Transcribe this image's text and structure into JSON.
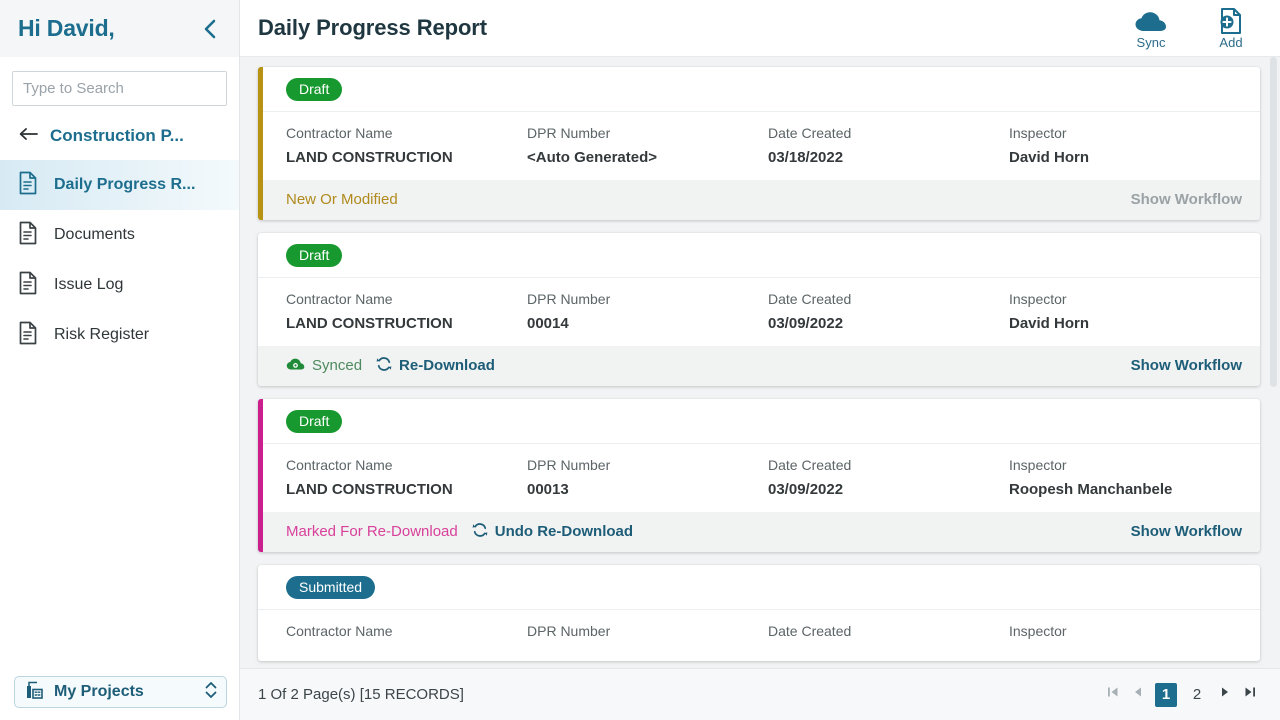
{
  "sidebar": {
    "greeting": "Hi David,",
    "collapse_icon": "chevron-left-icon",
    "search": {
      "placeholder": "Type to Search",
      "value": "",
      "button_icon": "search-icon"
    },
    "back_nav": {
      "icon": "arrow-left-icon",
      "label": "Construction P..."
    },
    "items": [
      {
        "icon": "document-icon",
        "label": "Daily Progress R...",
        "active": true
      },
      {
        "icon": "document-icon",
        "label": "Documents",
        "active": false
      },
      {
        "icon": "document-icon",
        "label": "Issue Log",
        "active": false
      },
      {
        "icon": "document-icon",
        "label": "Risk Register",
        "active": false
      }
    ],
    "projects_selector": {
      "icon": "building-icon",
      "label": "My Projects",
      "chevron_icon": "chevron-up-down-icon"
    }
  },
  "header": {
    "title": "Daily Progress Report",
    "actions": [
      {
        "icon": "cloud-icon",
        "label": "Sync"
      },
      {
        "icon": "document-add-icon",
        "label": "Add"
      }
    ]
  },
  "colors": {
    "accent_teal": "#1d6e8e",
    "badge_draft": "#18992f",
    "badge_submitted": "#1d6e8e",
    "accent_gold": "#b89313",
    "accent_magenta": "#cc1f8e",
    "link_blue": "#1d5d78",
    "synced_green": "#1f8a37",
    "disabled_grey": "#9aa2a6"
  },
  "columns": [
    "Contractor Name",
    "DPR Number",
    "Date Created",
    "Inspector"
  ],
  "cards": [
    {
      "status_badge": "Draft",
      "badge_color": "#18992f",
      "accent_color": "#b89313",
      "values": [
        "LAND CONSTRUCTION",
        "<Auto Generated>",
        "03/18/2022",
        "David Horn"
      ],
      "foot_status": "New Or Modified",
      "foot_status_color": "#b08a1c",
      "foot_status_icon": "",
      "foot_action": "",
      "foot_action_icon": "",
      "workflow_label": "Show Workflow",
      "workflow_color": "#9aa2a6"
    },
    {
      "status_badge": "Draft",
      "badge_color": "#18992f",
      "accent_color": "",
      "values": [
        "LAND CONSTRUCTION",
        "00014",
        "03/09/2022",
        "David Horn"
      ],
      "foot_status": "Synced",
      "foot_status_color": "#1f8a37",
      "foot_status_icon": "cloud-check-icon",
      "foot_action": "Re-Download",
      "foot_action_icon": "refresh-icon",
      "workflow_label": "Show Workflow",
      "workflow_color": "#1d5d78"
    },
    {
      "status_badge": "Draft",
      "badge_color": "#18992f",
      "accent_color": "#cc1f8e",
      "values": [
        "LAND CONSTRUCTION",
        "00013",
        "03/09/2022",
        "Roopesh Manchanbele"
      ],
      "foot_status": "Marked For Re-Download",
      "foot_status_color": "#d8419a",
      "foot_status_icon": "",
      "foot_action": "Undo Re-Download",
      "foot_action_icon": "refresh-icon",
      "workflow_label": "Show Workflow",
      "workflow_color": "#1d5d78"
    },
    {
      "status_badge": "Submitted",
      "badge_color": "#1d6e8e",
      "accent_color": "",
      "values": [
        "",
        "",
        "",
        ""
      ],
      "foot_status": "",
      "foot_status_color": "",
      "foot_status_icon": "",
      "foot_action": "",
      "foot_action_icon": "",
      "workflow_label": "",
      "workflow_color": ""
    }
  ],
  "footer": {
    "records_text": "1 Of 2 Page(s) [15 RECORDS]",
    "pager": {
      "first_icon": "page-first-icon",
      "prev_icon": "page-prev-icon",
      "pages": [
        "1",
        "2"
      ],
      "active_page": "1",
      "next_icon": "page-next-icon",
      "last_icon": "page-last-icon"
    }
  }
}
